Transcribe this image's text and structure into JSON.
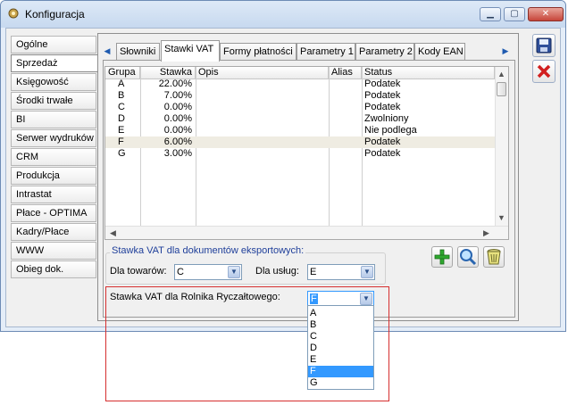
{
  "window": {
    "title": "Konfiguracja",
    "controls": {
      "minimize": "▁",
      "maximize": "▢",
      "close": "✕"
    }
  },
  "nav": {
    "items": [
      {
        "label": "Ogólne"
      },
      {
        "label": "Sprzedaż",
        "active": true
      },
      {
        "label": "Księgowość"
      },
      {
        "label": "Środki trwałe"
      },
      {
        "label": "BI"
      },
      {
        "label": "Serwer wydruków"
      },
      {
        "label": "CRM"
      },
      {
        "label": "Produkcja"
      },
      {
        "label": "Intrastat"
      },
      {
        "label": "Płace - OPTIMA"
      },
      {
        "label": "Kadry/Płace"
      },
      {
        "label": "WWW"
      },
      {
        "label": "Obieg dok."
      }
    ]
  },
  "tabs": {
    "items": [
      "Słowniki",
      "Stawki VAT",
      "Formy płatności",
      "Parametry 1",
      "Parametry 2",
      "Kody EAN"
    ],
    "active": "Stawki VAT"
  },
  "grid": {
    "columns": [
      "Grupa",
      "Stawka",
      "Opis",
      "Alias",
      "Status"
    ],
    "rows": [
      {
        "grupa": "A",
        "stawka": "22.00%",
        "opis": "",
        "alias": "",
        "status": "Podatek"
      },
      {
        "grupa": "B",
        "stawka": "7.00%",
        "opis": "",
        "alias": "",
        "status": "Podatek"
      },
      {
        "grupa": "C",
        "stawka": "0.00%",
        "opis": "",
        "alias": "",
        "status": "Podatek"
      },
      {
        "grupa": "D",
        "stawka": "0.00%",
        "opis": "",
        "alias": "",
        "status": "Zwolniony"
      },
      {
        "grupa": "E",
        "stawka": "0.00%",
        "opis": "",
        "alias": "",
        "status": "Nie podlega"
      },
      {
        "grupa": "F",
        "stawka": "6.00%",
        "opis": "",
        "alias": "",
        "status": "Podatek",
        "selected": true
      },
      {
        "grupa": "G",
        "stawka": "3.00%",
        "opis": "",
        "alias": "",
        "status": "Podatek"
      }
    ]
  },
  "export_group": {
    "legend": "Stawka VAT dla dokumentów eksportowych:",
    "towary_label": "Dla towarów:",
    "towary_value": "C",
    "uslugi_label": "Dla usług:",
    "uslugi_value": "E"
  },
  "rolnik": {
    "label": "Stawka VAT dla Rolnika Ryczałtowego:",
    "value": "F",
    "options": [
      "A",
      "B",
      "C",
      "D",
      "E",
      "F",
      "G"
    ],
    "highlighted": "F"
  },
  "icons": {
    "save": "floppy-disk-icon",
    "cancel": "red-x-icon",
    "add": "green-plus-icon",
    "search": "magnifier-icon",
    "delete": "trash-bin-icon"
  },
  "colors": {
    "selection_blue": "#3399ff",
    "legend_blue": "#1f3f9a",
    "annotation_red": "#d62f2f",
    "selected_row": "#efece2"
  }
}
